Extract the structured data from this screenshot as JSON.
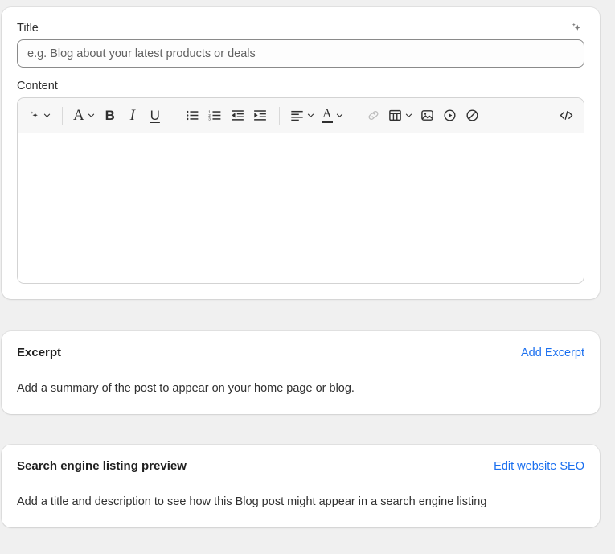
{
  "title_field": {
    "label": "Title",
    "placeholder": "e.g. Blog about your latest products or deals",
    "value": "",
    "ai_icon": "sparkle-icon"
  },
  "content_field": {
    "label": "Content",
    "value": "",
    "toolbar": [
      {
        "name": "ai-writer",
        "icon": "sparkle-icon",
        "caret": true,
        "label": "",
        "disabled": false
      },
      {
        "name": "separator-1",
        "icon": "separator",
        "caret": false,
        "label": "",
        "disabled": false
      },
      {
        "name": "paragraph-style",
        "icon": "letter-a-icon",
        "caret": true,
        "label": "A",
        "disabled": false
      },
      {
        "name": "bold",
        "icon": "bold-icon",
        "caret": false,
        "label": "B",
        "disabled": false
      },
      {
        "name": "italic",
        "icon": "italic-icon",
        "caret": false,
        "label": "I",
        "disabled": false
      },
      {
        "name": "underline",
        "icon": "underline-icon",
        "caret": false,
        "label": "U",
        "disabled": false
      },
      {
        "name": "separator-2",
        "icon": "separator",
        "caret": false,
        "label": "",
        "disabled": false
      },
      {
        "name": "bulleted-list",
        "icon": "bulleted-list-icon",
        "caret": false,
        "label": "",
        "disabled": false
      },
      {
        "name": "numbered-list",
        "icon": "numbered-list-icon",
        "caret": false,
        "label": "",
        "disabled": false
      },
      {
        "name": "outdent",
        "icon": "outdent-icon",
        "caret": false,
        "label": "",
        "disabled": false
      },
      {
        "name": "indent",
        "icon": "indent-icon",
        "caret": false,
        "label": "",
        "disabled": false
      },
      {
        "name": "separator-3",
        "icon": "separator",
        "caret": false,
        "label": "",
        "disabled": false
      },
      {
        "name": "text-align",
        "icon": "align-left-icon",
        "caret": true,
        "label": "",
        "disabled": false
      },
      {
        "name": "text-color",
        "icon": "text-color-icon",
        "caret": true,
        "label": "A",
        "disabled": false
      },
      {
        "name": "separator-4",
        "icon": "separator",
        "caret": false,
        "label": "",
        "disabled": false
      },
      {
        "name": "insert-link",
        "icon": "link-icon",
        "caret": false,
        "label": "",
        "disabled": true
      },
      {
        "name": "insert-table",
        "icon": "table-icon",
        "caret": true,
        "label": "",
        "disabled": false
      },
      {
        "name": "insert-image",
        "icon": "image-icon",
        "caret": false,
        "label": "",
        "disabled": false
      },
      {
        "name": "insert-video",
        "icon": "video-icon",
        "caret": false,
        "label": "",
        "disabled": false
      },
      {
        "name": "clear-formatting",
        "icon": "no-symbol-icon",
        "caret": false,
        "label": "",
        "disabled": false
      },
      {
        "name": "spacer",
        "icon": "spacer",
        "caret": false,
        "label": "",
        "disabled": false
      },
      {
        "name": "edit-html",
        "icon": "code-icon",
        "caret": false,
        "label": "</>",
        "disabled": false
      }
    ]
  },
  "excerpt": {
    "title": "Excerpt",
    "action": "Add Excerpt",
    "description": "Add a summary of the post to appear on your home page or blog."
  },
  "seo": {
    "title": "Search engine listing preview",
    "action": "Edit website SEO",
    "description": "Add a title and description to see how this Blog post might appear in a search engine listing"
  },
  "colors": {
    "page_background": "#f0f0f0",
    "card_background": "#ffffff",
    "text": "#303030",
    "heading": "#1f1f1f",
    "link": "#1a6fef",
    "toolbar_background": "#f7f7f7",
    "border": "#d3d3d3",
    "input_border": "#8a8a8a",
    "disabled_icon": "#b8b8b8"
  }
}
